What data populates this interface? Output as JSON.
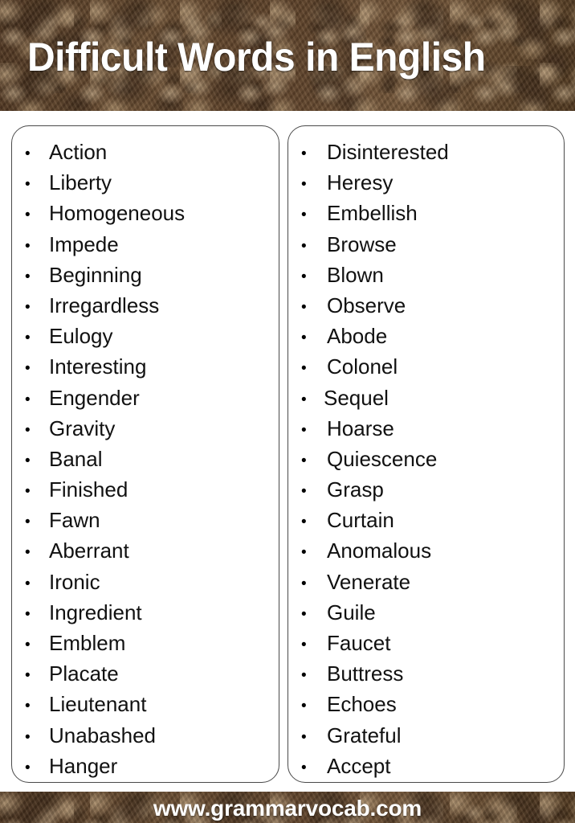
{
  "header": {
    "title": "Difficult Words in English",
    "background": "brown-textured",
    "text_color": "#ffffff"
  },
  "footer": {
    "url": "www.grammarvocab.com",
    "background": "brown-textured",
    "text_color": "#ffffff"
  },
  "colors": {
    "band_dark_brown": "#4c3420",
    "band_mid_brown": "#6a4e33",
    "band_light_tan": "#b59a78",
    "card_background": "#ffffff",
    "card_border": "#4a4a4a",
    "body_text": "#111111",
    "page_background": "#ffffff"
  },
  "columns": [
    {
      "name": "left-column",
      "bullet": "•",
      "items": [
        "Action",
        "Liberty",
        "Homogeneous",
        "Impede",
        "Beginning",
        "Irregardless",
        "Eulogy",
        "Interesting",
        "Engender",
        "Gravity",
        "Banal",
        "Finished",
        "Fawn",
        "Aberrant",
        "Ironic",
        "Ingredient",
        "Emblem",
        "Placate",
        "Lieutenant",
        "Unabashed",
        "Hanger"
      ]
    },
    {
      "name": "right-column",
      "bullet": "•",
      "items": [
        "Disinterested",
        "Heresy",
        "Embellish",
        "Browse",
        "Blown",
        "Observe",
        "Abode",
        "Colonel",
        "Sequel",
        "Hoarse",
        "Quiescence",
        "Grasp",
        "Curtain",
        "Anomalous",
        "Venerate",
        "Guile",
        "Faucet",
        "Buttress",
        "Echoes",
        "Grateful",
        "Accept"
      ]
    }
  ]
}
